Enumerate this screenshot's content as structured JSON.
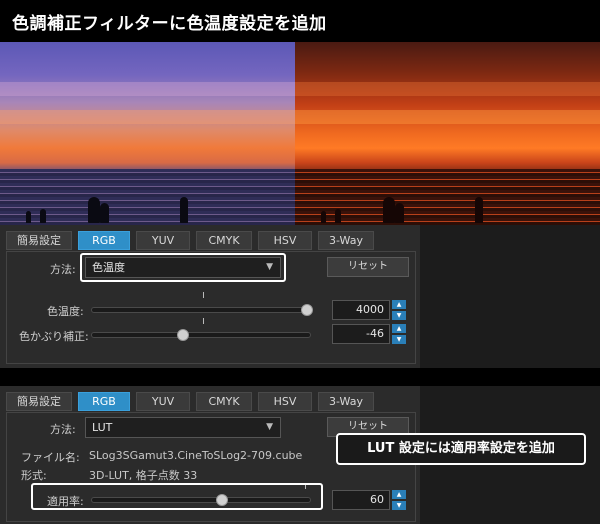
{
  "header": {
    "title": "色調補正フィルターに色温度設定を追加"
  },
  "tabs": [
    "簡易設定",
    "RGB",
    "YUV",
    "CMYK",
    "HSV",
    "3-Way"
  ],
  "active_tab": "RGB",
  "panel1": {
    "method_label": "方法:",
    "method_value": "色温度",
    "reset_label": "リセット",
    "sliders": [
      {
        "label": "色温度:",
        "value": "4000",
        "position": 0.94
      },
      {
        "label": "色かぶり補正:",
        "value": "-46",
        "position": 0.4
      }
    ]
  },
  "panel2": {
    "method_label": "方法:",
    "method_value": "LUT",
    "reset_label": "リセット",
    "file_label": "ファイル名:",
    "file_value": "SLog3SGamut3.CineToSLog2-709.cube",
    "format_label": "形式:",
    "format_value": "3D-LUT, 格子点数 33",
    "slider": {
      "label": "適用率:",
      "value": "60",
      "position": 0.6
    }
  },
  "callout": {
    "text": "LUT 設定には適用率設定を追加"
  },
  "icons": {
    "dropdown": "chevron-down-icon",
    "spin_up": "triangle-up-icon",
    "spin_down": "triangle-down-icon"
  },
  "colors": {
    "accent": "#2f8fc8",
    "panel": "#2b2b2b"
  }
}
